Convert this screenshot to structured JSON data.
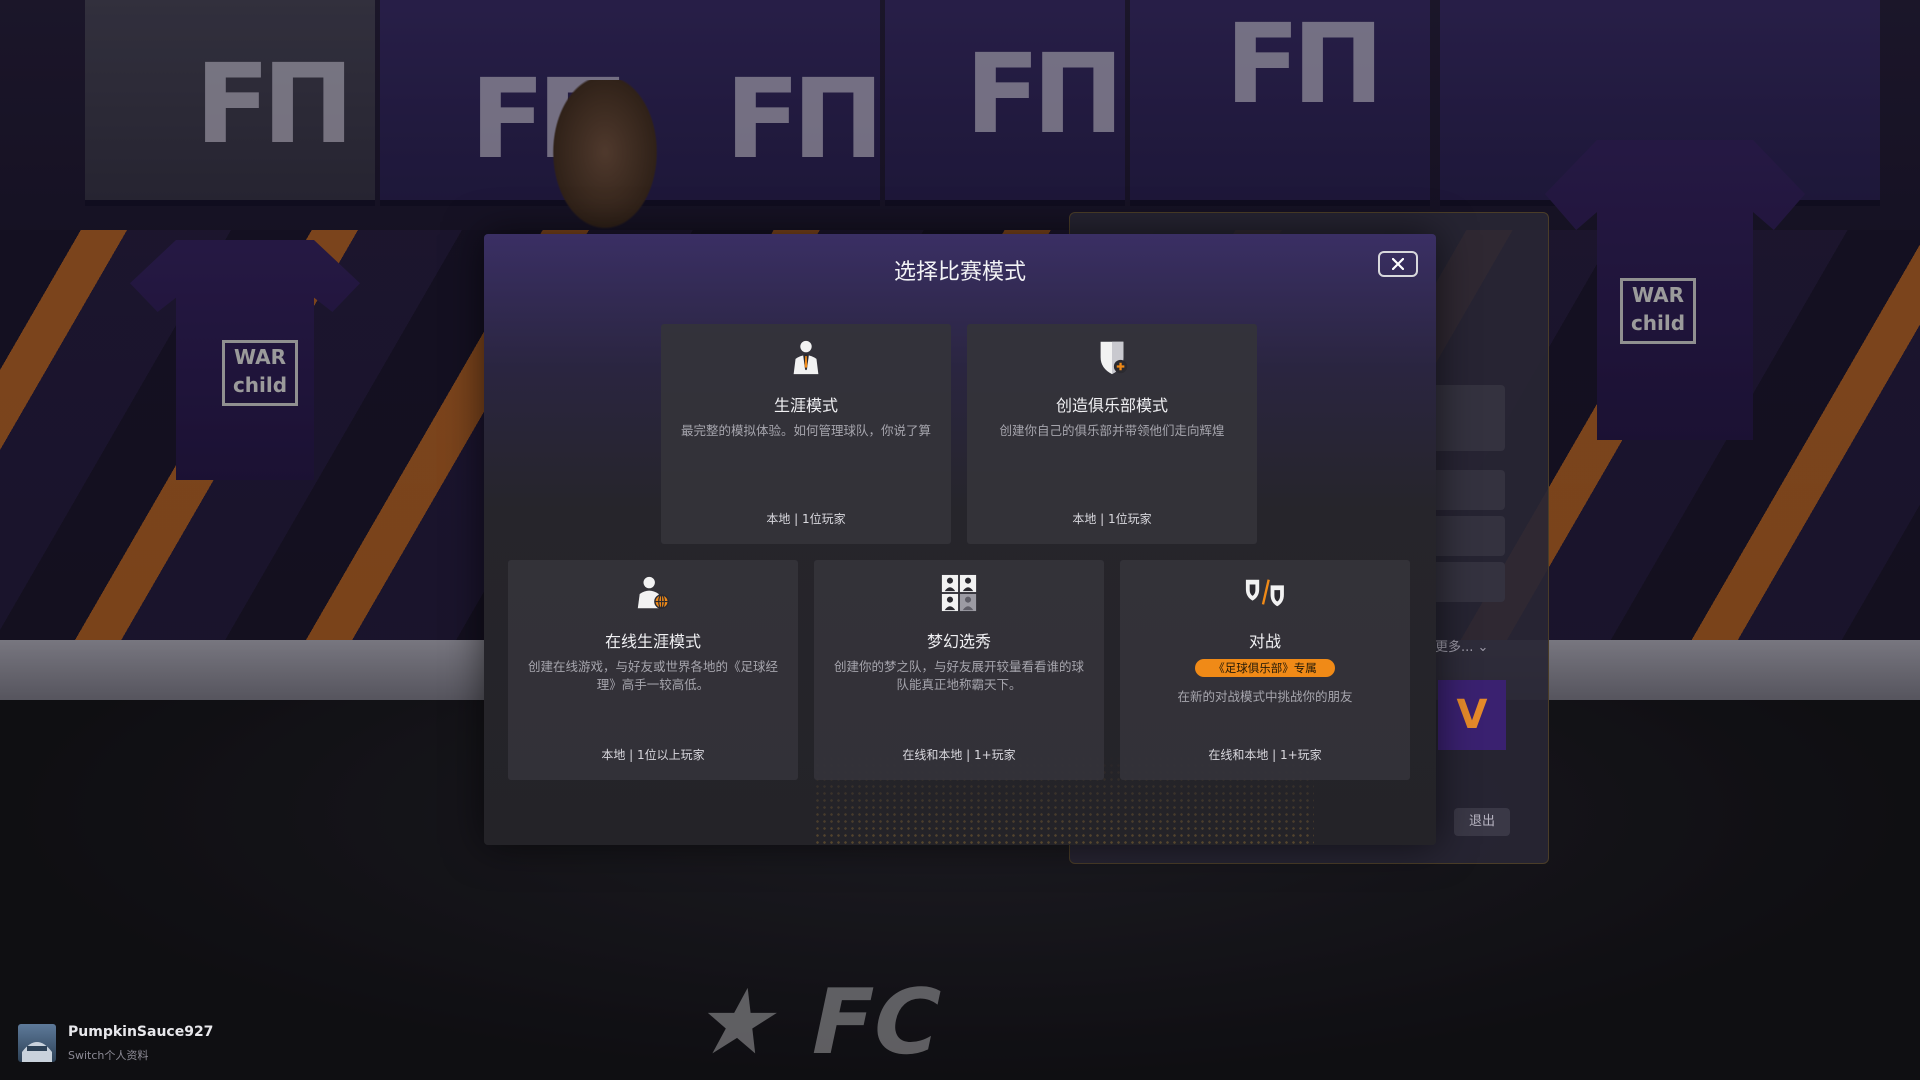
{
  "modal": {
    "title": "选择比赛模式",
    "close_icon": "close-icon"
  },
  "modes": [
    {
      "title": "生涯模式",
      "description": "最完整的模拟体验。如何管理球队，你说了算",
      "footer": "本地 | 1位玩家",
      "icon": "manager-icon"
    },
    {
      "title": "创造俱乐部模式",
      "description": "创建你自己的俱乐部并带领他们走向辉煌",
      "footer": "本地 | 1位玩家",
      "icon": "create-club-shield-icon"
    },
    {
      "title": "在线生涯模式",
      "description": "创建在线游戏，与好友或世界各地的《足球经理》高手一较高低。",
      "footer": "本地 | 1位以上玩家",
      "icon": "online-manager-icon"
    },
    {
      "title": "梦幻选秀",
      "description": "创建你的梦之队，与好友展开较量看看谁的球队能真正地称霸天下。",
      "footer": "在线和本地 | 1+玩家",
      "icon": "fantasy-draft-icon"
    },
    {
      "title": "对战",
      "badge": "《足球俱乐部》专属",
      "description": "在新的对战模式中挑战你的朋友",
      "footer": "在线和本地 | 1+玩家",
      "icon": "versus-shields-icon"
    }
  ],
  "side_panel": {
    "more_label": "更多...",
    "exit_label": "退出"
  },
  "profile": {
    "name": "PumpkinSauce927",
    "subtitle": "Switch个人资料"
  },
  "colors": {
    "accent_orange": "#f08a17",
    "club_purple": "#3a2668",
    "card_bg": "#34333a"
  }
}
